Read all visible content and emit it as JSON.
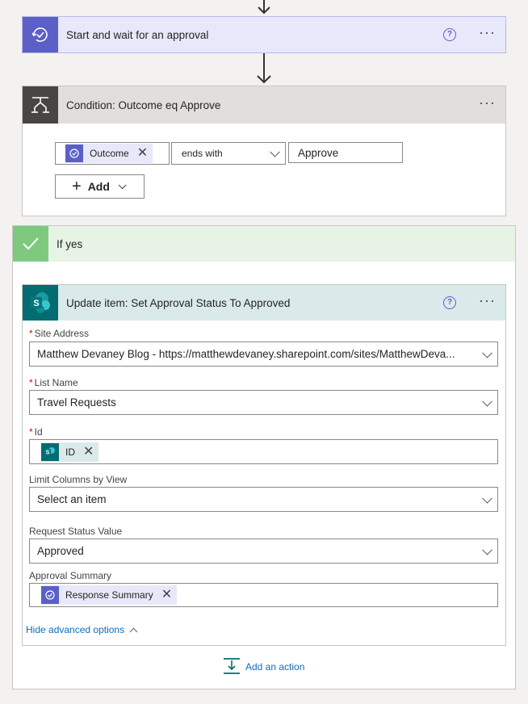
{
  "flow": {
    "approval_step": {
      "title": "Start and wait for an approval",
      "help": "?",
      "menu": "···"
    },
    "condition": {
      "title": "Condition: Outcome eq Approve",
      "menu": "···",
      "token_label": "Outcome",
      "operator": "ends with",
      "value": "Approve",
      "add_label": "Add"
    },
    "if_yes": {
      "title": "If yes"
    },
    "update_item": {
      "title": "Update item: Set Approval Status To Approved",
      "help": "?",
      "menu": "···",
      "site_address_label": "Site Address",
      "site_address_value": "Matthew Devaney Blog - https://matthewdevaney.sharepoint.com/sites/MatthewDeva...",
      "list_name_label": "List Name",
      "list_name_value": "Travel Requests",
      "id_label": "Id",
      "id_token": "ID",
      "limit_columns_label": "Limit Columns by View",
      "limit_columns_placeholder": "Select an item",
      "request_status_label": "Request Status Value",
      "request_status_value": "Approved",
      "approval_summary_label": "Approval Summary",
      "approval_summary_token": "Response Summary",
      "hide_advanced": "Hide advanced options",
      "required_mark": "*"
    },
    "add_action": "Add an action"
  },
  "colors": {
    "approval_accent": "#5b5fc7",
    "approval_header_bg": "#e8e8fb",
    "condition_accent": "#484644",
    "condition_header_bg": "#e1dfdd",
    "yes_accent": "#7fc97f",
    "yes_header_bg": "#e7f3e5",
    "sharepoint_accent": "#036c70",
    "sharepoint_header_bg": "#daeaea",
    "link": "#0f6cbd"
  }
}
